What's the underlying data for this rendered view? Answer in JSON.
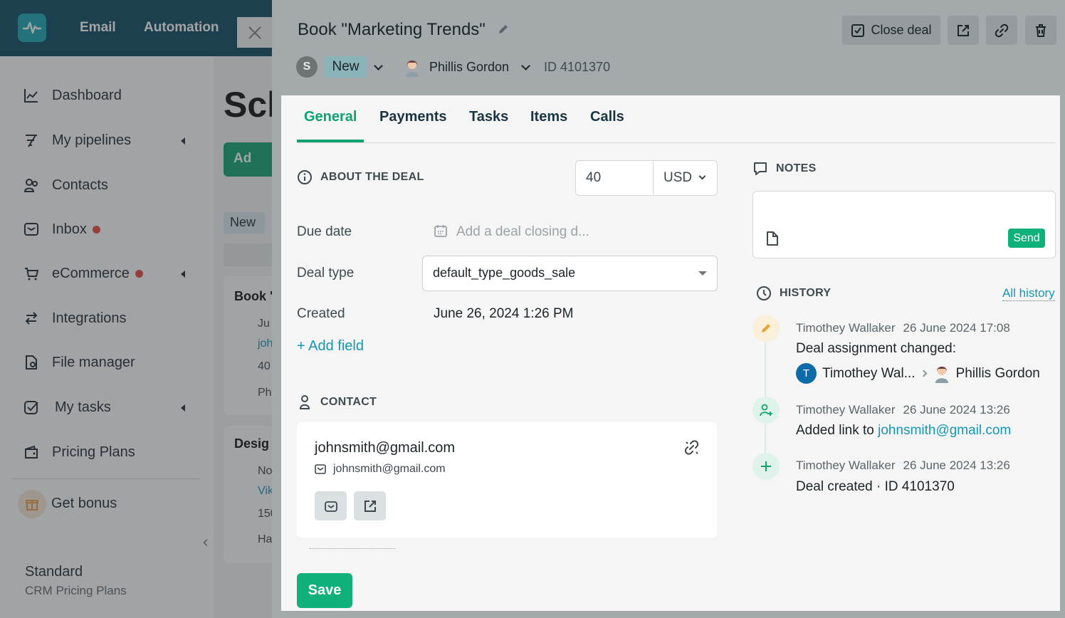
{
  "app": {
    "topnav": [
      "Email",
      "Automation"
    ],
    "sidebar": {
      "items": [
        {
          "label": "Dashboard",
          "icon": "chart-line-icon"
        },
        {
          "label": "My pipelines",
          "icon": "funnel-icon"
        },
        {
          "label": "Contacts",
          "icon": "contacts-icon"
        },
        {
          "label": "Inbox",
          "icon": "inbox-icon"
        },
        {
          "label": "eCommerce",
          "icon": "cart-icon"
        },
        {
          "label": "Integrations",
          "icon": "arrows-icon"
        },
        {
          "label": "File manager",
          "icon": "file-icon"
        },
        {
          "label": "My tasks",
          "icon": "checkbox-icon"
        },
        {
          "label": "Pricing Plans",
          "icon": "wallet-icon"
        }
      ],
      "bonus": "Get bonus",
      "plan_name": "Standard",
      "plan_sub": "CRM Pricing Plans"
    },
    "main": {
      "page_title": "Scl",
      "add_button": "Ad",
      "column_tag": "New",
      "card1": {
        "title": "Book '",
        "lines": [
          "Ju",
          "joh",
          "40",
          "Ph"
        ]
      },
      "card2": {
        "title": "Desig",
        "lines": [
          "No",
          "Vik",
          "150",
          "Ha"
        ]
      }
    }
  },
  "deal": {
    "title": "Book \"Marketing Trends\"",
    "close_deal": "Close deal",
    "status_initial": "S",
    "status": "New",
    "owner": "Phillis Gordon",
    "id_text": "ID 4101370",
    "tabs": [
      "General",
      "Payments",
      "Tasks",
      "Items",
      "Calls"
    ],
    "about": {
      "heading": "ABOUT THE DEAL",
      "amount": "40",
      "currency": "USD",
      "due_label": "Due date",
      "due_placeholder": "Add a deal closing d...",
      "type_label": "Deal type",
      "type_value": "default_type_goods_sale",
      "created_label": "Created",
      "created_value": "June 26, 2024 1:26 PM",
      "add_field": "+ Add field"
    },
    "contact": {
      "heading": "CONTACT",
      "name": "johnsmith@gmail.com",
      "email": "johnsmith@gmail.com"
    },
    "save": "Save",
    "notes": {
      "heading": "NOTES",
      "send": "Send"
    },
    "history": {
      "heading": "HISTORY",
      "all_link": "All history",
      "events": [
        {
          "author": "Timothey Wallaker",
          "time": "26 June 2024 17:08",
          "text": "Deal assignment changed:",
          "from_initial": "T",
          "from": "Timothey Wal...",
          "to": "Phillis Gordon"
        },
        {
          "author": "Timothey Wallaker",
          "time": "26 June 2024 13:26",
          "text": "Added link to",
          "link": "johnsmith@gmail.com"
        },
        {
          "author": "Timothey Wallaker",
          "time": "26 June 2024 13:26",
          "text": "Deal created · ID 4101370"
        }
      ]
    }
  },
  "colors": {
    "accent": "#10a36f",
    "link": "#1596b5",
    "topbar": "#0e4c63"
  }
}
